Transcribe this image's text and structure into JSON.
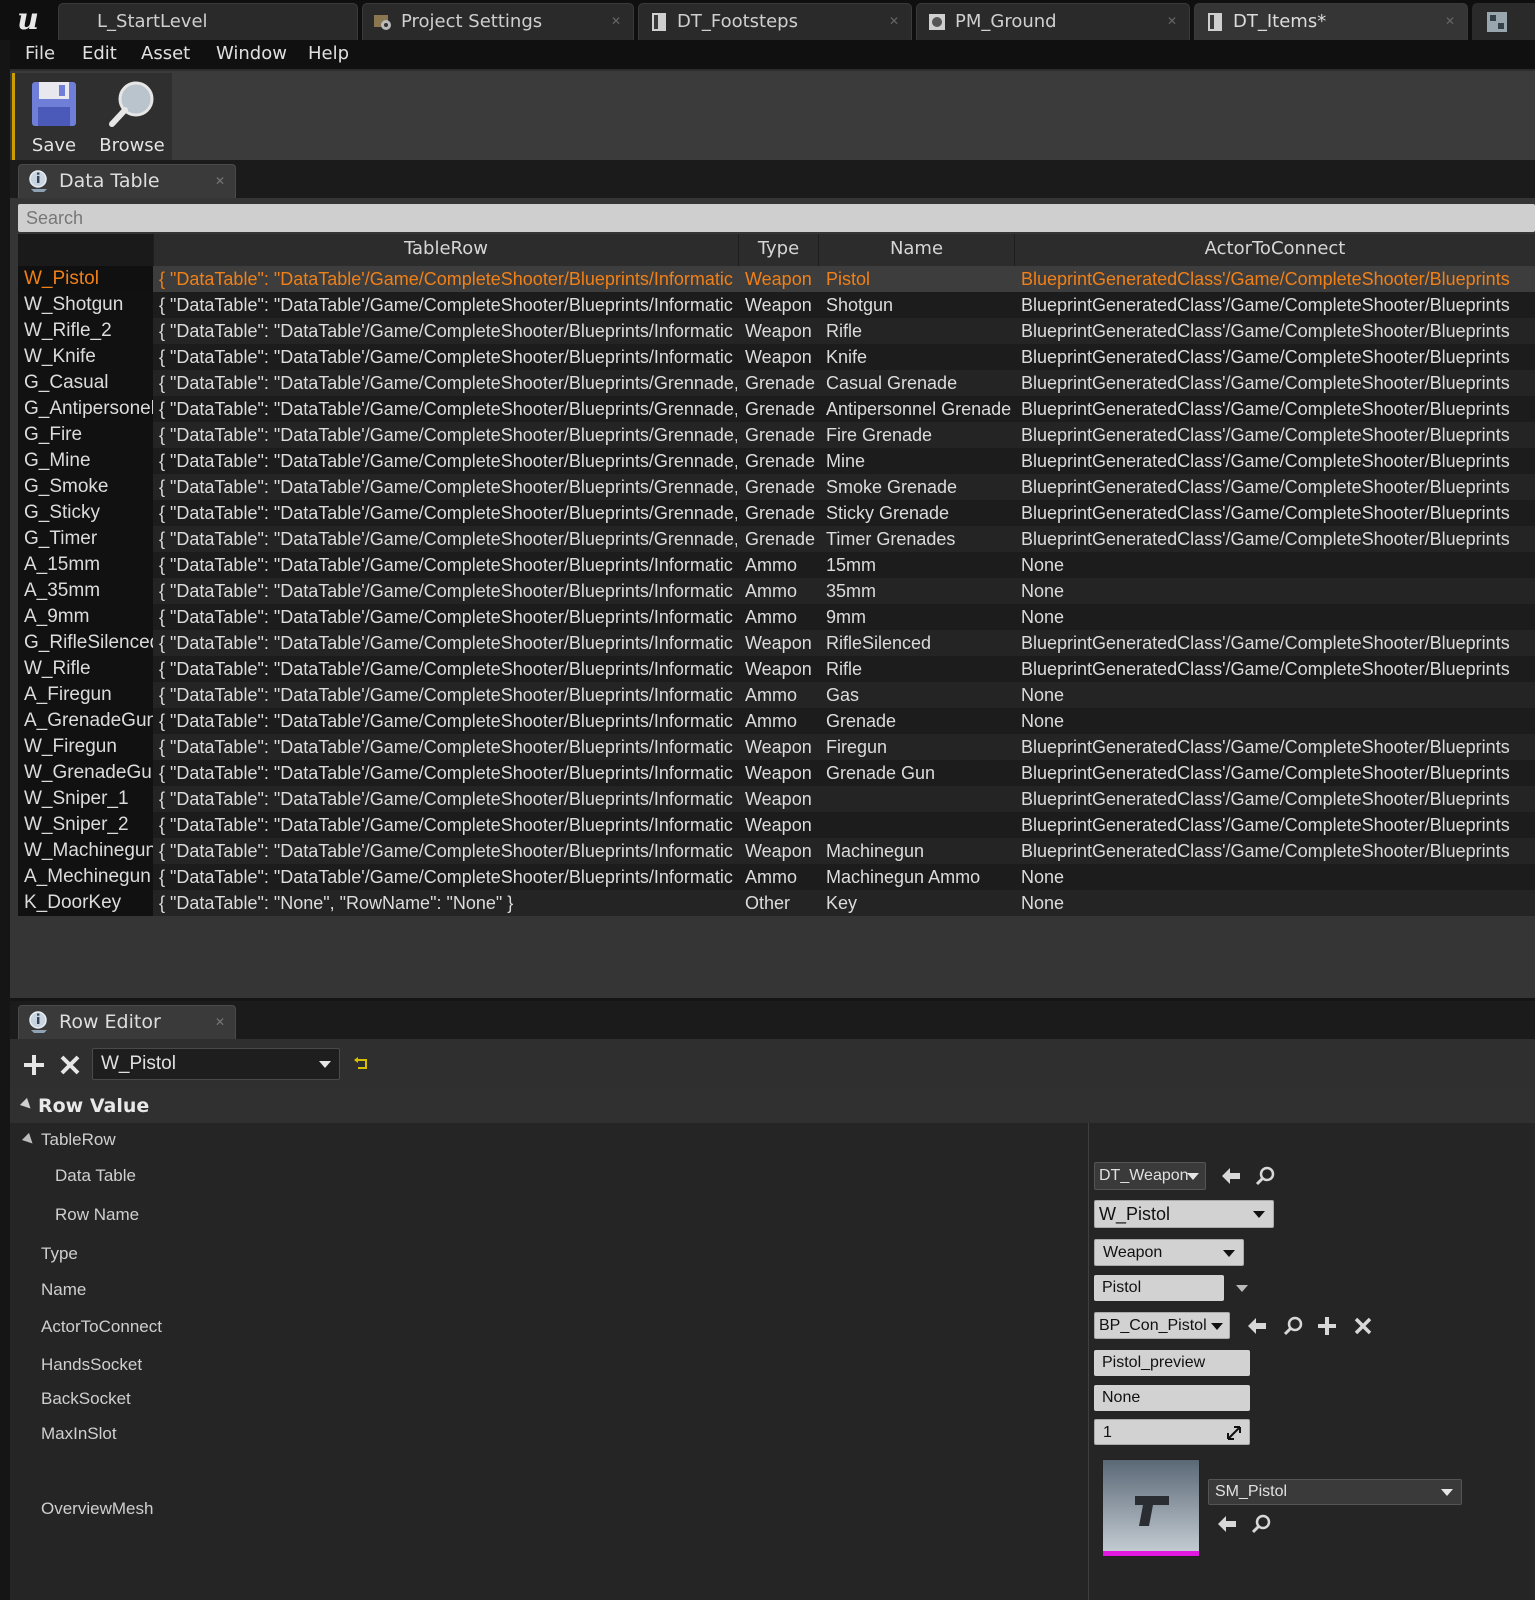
{
  "tabs": [
    {
      "label": "L_StartLevel",
      "icon": "level-icon"
    },
    {
      "label": "Project Settings",
      "icon": "settings-icon"
    },
    {
      "label": "DT_Footsteps",
      "icon": "datatable-icon"
    },
    {
      "label": "PM_Ground",
      "icon": "physical-material-icon"
    },
    {
      "label": "DT_Items*",
      "icon": "datatable-icon"
    }
  ],
  "menu": [
    "File",
    "Edit",
    "Asset",
    "Window",
    "Help"
  ],
  "toolbar": {
    "save_label": "Save",
    "browse_label": "Browse"
  },
  "data_table_panel": {
    "tab_label": "Data Table",
    "search_placeholder": "Search",
    "columns": [
      "TableRow",
      "Type",
      "Name",
      "ActorToConnect"
    ],
    "selected_row": "W_Pistol",
    "rows": [
      {
        "row_name": "W_Pistol",
        "table_row": "{ \"DataTable\": \"DataTable'/Game/CompleteShooter/Blueprints/Informatic",
        "type": "Weapon",
        "name": "Pistol",
        "actor": "BlueprintGeneratedClass'/Game/CompleteShooter/Blueprints"
      },
      {
        "row_name": "W_Shotgun",
        "table_row": "{ \"DataTable\": \"DataTable'/Game/CompleteShooter/Blueprints/Informatic",
        "type": "Weapon",
        "name": "Shotgun",
        "actor": "BlueprintGeneratedClass'/Game/CompleteShooter/Blueprints"
      },
      {
        "row_name": "W_Rifle_2",
        "table_row": "{ \"DataTable\": \"DataTable'/Game/CompleteShooter/Blueprints/Informatic",
        "type": "Weapon",
        "name": "Rifle",
        "actor": "BlueprintGeneratedClass'/Game/CompleteShooter/Blueprints"
      },
      {
        "row_name": "W_Knife",
        "table_row": "{ \"DataTable\": \"DataTable'/Game/CompleteShooter/Blueprints/Informatic",
        "type": "Weapon",
        "name": "Knife",
        "actor": "BlueprintGeneratedClass'/Game/CompleteShooter/Blueprints"
      },
      {
        "row_name": "G_Casual",
        "table_row": "{ \"DataTable\": \"DataTable'/Game/CompleteShooter/Blueprints/Grennade,",
        "type": "Grenade",
        "name": "Casual Grenade",
        "actor": "BlueprintGeneratedClass'/Game/CompleteShooter/Blueprints"
      },
      {
        "row_name": "G_Antipersonel",
        "table_row": "{ \"DataTable\": \"DataTable'/Game/CompleteShooter/Blueprints/Grennade,",
        "type": "Grenade",
        "name": "Antipersonnel Grenade",
        "actor": "BlueprintGeneratedClass'/Game/CompleteShooter/Blueprints"
      },
      {
        "row_name": "G_Fire",
        "table_row": "{ \"DataTable\": \"DataTable'/Game/CompleteShooter/Blueprints/Grennade,",
        "type": "Grenade",
        "name": "Fire Grenade",
        "actor": "BlueprintGeneratedClass'/Game/CompleteShooter/Blueprints"
      },
      {
        "row_name": "G_Mine",
        "table_row": "{ \"DataTable\": \"DataTable'/Game/CompleteShooter/Blueprints/Grennade,",
        "type": "Grenade",
        "name": "Mine",
        "actor": "BlueprintGeneratedClass'/Game/CompleteShooter/Blueprints"
      },
      {
        "row_name": "G_Smoke",
        "table_row": "{ \"DataTable\": \"DataTable'/Game/CompleteShooter/Blueprints/Grennade,",
        "type": "Grenade",
        "name": "Smoke Grenade",
        "actor": "BlueprintGeneratedClass'/Game/CompleteShooter/Blueprints"
      },
      {
        "row_name": "G_Sticky",
        "table_row": "{ \"DataTable\": \"DataTable'/Game/CompleteShooter/Blueprints/Grennade,",
        "type": "Grenade",
        "name": "Sticky Grenade",
        "actor": "BlueprintGeneratedClass'/Game/CompleteShooter/Blueprints"
      },
      {
        "row_name": "G_Timer",
        "table_row": "{ \"DataTable\": \"DataTable'/Game/CompleteShooter/Blueprints/Grennade,",
        "type": "Grenade",
        "name": "Timer Grenades",
        "actor": "BlueprintGeneratedClass'/Game/CompleteShooter/Blueprints"
      },
      {
        "row_name": "A_15mm",
        "table_row": "{ \"DataTable\": \"DataTable'/Game/CompleteShooter/Blueprints/Informatic",
        "type": "Ammo",
        "name": "15mm",
        "actor": "None"
      },
      {
        "row_name": "A_35mm",
        "table_row": "{ \"DataTable\": \"DataTable'/Game/CompleteShooter/Blueprints/Informatic",
        "type": "Ammo",
        "name": "35mm",
        "actor": "None"
      },
      {
        "row_name": "A_9mm",
        "table_row": "{ \"DataTable\": \"DataTable'/Game/CompleteShooter/Blueprints/Informatic",
        "type": "Ammo",
        "name": "9mm",
        "actor": "None"
      },
      {
        "row_name": "G_RifleSilenced",
        "table_row": "{ \"DataTable\": \"DataTable'/Game/CompleteShooter/Blueprints/Informatic",
        "type": "Weapon",
        "name": "RifleSilenced",
        "actor": "BlueprintGeneratedClass'/Game/CompleteShooter/Blueprints"
      },
      {
        "row_name": "W_Rifle",
        "table_row": "{ \"DataTable\": \"DataTable'/Game/CompleteShooter/Blueprints/Informatic",
        "type": "Weapon",
        "name": "Rifle",
        "actor": "BlueprintGeneratedClass'/Game/CompleteShooter/Blueprints"
      },
      {
        "row_name": "A_Firegun",
        "table_row": "{ \"DataTable\": \"DataTable'/Game/CompleteShooter/Blueprints/Informatic",
        "type": "Ammo",
        "name": "Gas",
        "actor": "None"
      },
      {
        "row_name": "A_GrenadeGun",
        "table_row": "{ \"DataTable\": \"DataTable'/Game/CompleteShooter/Blueprints/Informatic",
        "type": "Ammo",
        "name": "Grenade",
        "actor": "None"
      },
      {
        "row_name": "W_Firegun",
        "table_row": "{ \"DataTable\": \"DataTable'/Game/CompleteShooter/Blueprints/Informatic",
        "type": "Weapon",
        "name": "Firegun",
        "actor": "BlueprintGeneratedClass'/Game/CompleteShooter/Blueprints"
      },
      {
        "row_name": "W_GrenadeGun",
        "table_row": "{ \"DataTable\": \"DataTable'/Game/CompleteShooter/Blueprints/Informatic",
        "type": "Weapon",
        "name": "Grenade Gun",
        "actor": "BlueprintGeneratedClass'/Game/CompleteShooter/Blueprints"
      },
      {
        "row_name": "W_Sniper_1",
        "table_row": "{ \"DataTable\": \"DataTable'/Game/CompleteShooter/Blueprints/Informatic",
        "type": "Weapon",
        "name": "",
        "actor": "BlueprintGeneratedClass'/Game/CompleteShooter/Blueprints"
      },
      {
        "row_name": "W_Sniper_2",
        "table_row": "{ \"DataTable\": \"DataTable'/Game/CompleteShooter/Blueprints/Informatic",
        "type": "Weapon",
        "name": "",
        "actor": "BlueprintGeneratedClass'/Game/CompleteShooter/Blueprints"
      },
      {
        "row_name": "W_Machinegun",
        "table_row": "{ \"DataTable\": \"DataTable'/Game/CompleteShooter/Blueprints/Informatic",
        "type": "Weapon",
        "name": "Machinegun",
        "actor": "BlueprintGeneratedClass'/Game/CompleteShooter/Blueprints"
      },
      {
        "row_name": "A_Mechinegun",
        "table_row": "{ \"DataTable\": \"DataTable'/Game/CompleteShooter/Blueprints/Informatic",
        "type": "Ammo",
        "name": "Machinegun Ammo",
        "actor": "None"
      },
      {
        "row_name": "K_DoorKey",
        "table_row": "{ \"DataTable\": \"None\", \"RowName\": \"None\" }",
        "type": "Other",
        "name": "Key",
        "actor": "None"
      }
    ]
  },
  "row_editor": {
    "tab_label": "Row Editor",
    "selected_row": "W_Pistol",
    "section_title": "Row Value",
    "category": "TableRow",
    "labels": {
      "data_table": "Data Table",
      "row_name": "Row Name",
      "type": "Type",
      "name": "Name",
      "actor": "ActorToConnect",
      "hands_socket": "HandsSocket",
      "back_socket": "BackSocket",
      "max_in_slot": "MaxInSlot",
      "overview_mesh": "OverviewMesh"
    },
    "values": {
      "data_table": "DT_Weapon",
      "row_name": "W_Pistol",
      "type": "Weapon",
      "name": "Pistol",
      "actor": "BP_Con_Pistol",
      "hands_socket": "Pistol_preview",
      "back_socket": "None",
      "max_in_slot": "1",
      "overview_mesh": "SM_Pistol"
    }
  },
  "colors": {
    "selected_text": "#f08018",
    "accent": "#caa000",
    "thumbnail_bar": "#e018e0"
  }
}
